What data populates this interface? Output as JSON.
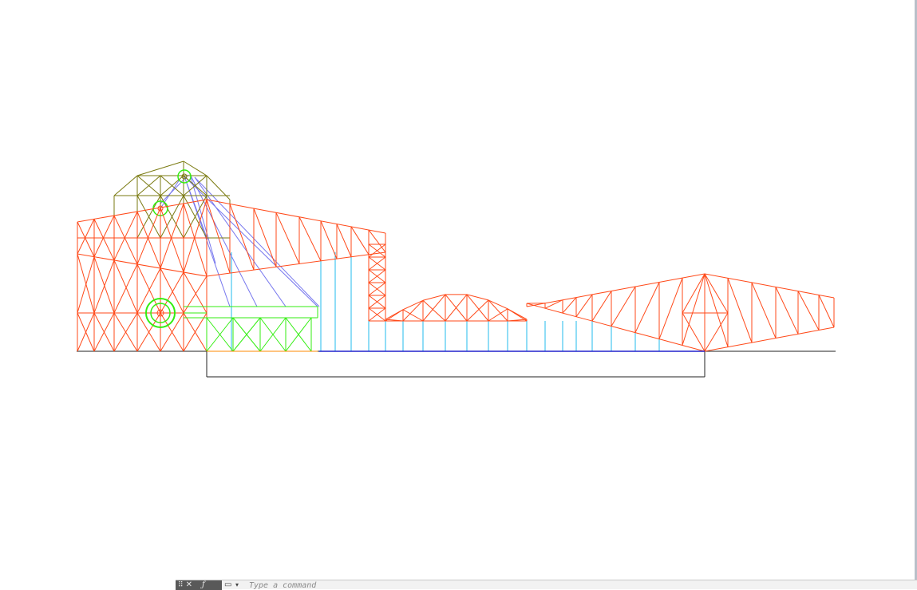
{
  "viewport": {
    "background": "#ffffff",
    "colors": {
      "orange_truss": "#ff4a1a",
      "olive_tower": "#7a7a10",
      "green_crane": "#33ee11",
      "cyan_hanger": "#22bbee",
      "blue_cable": "#7777ee",
      "deck_blue": "#2222cc",
      "ground_black": "#222222"
    },
    "drawing": "bridge-truss-elevation"
  },
  "command_line": {
    "grip_icon": "grip-icon",
    "close_icon": "close-icon",
    "customize_icon": "wrench-icon",
    "history_icon": "command-history-icon",
    "placeholder": "Type a command"
  }
}
